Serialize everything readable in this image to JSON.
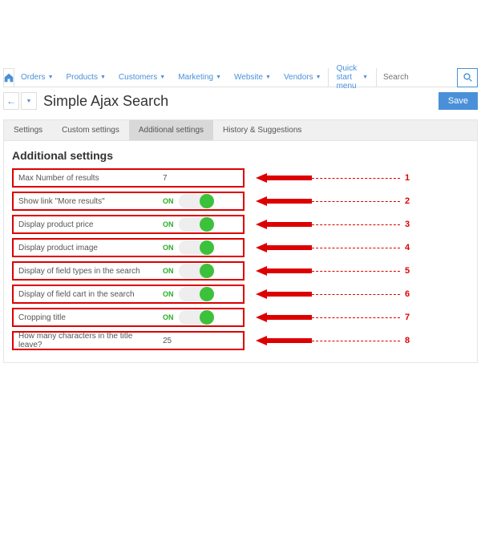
{
  "nav": {
    "items": [
      {
        "label": "Orders"
      },
      {
        "label": "Products"
      },
      {
        "label": "Customers"
      },
      {
        "label": "Marketing"
      },
      {
        "label": "Website"
      },
      {
        "label": "Vendors"
      }
    ],
    "quickstart": "Quick start menu",
    "search_placeholder": "Search"
  },
  "header": {
    "title": "Simple Ajax Search",
    "save": "Save"
  },
  "tabs": [
    {
      "label": "Settings"
    },
    {
      "label": "Custom settings"
    },
    {
      "label": "Additional settings"
    },
    {
      "label": "History & Suggestions"
    }
  ],
  "section_title": "Additional settings",
  "settings": [
    {
      "label": "Max Number of results",
      "type": "text",
      "value": "7",
      "num": "1"
    },
    {
      "label": "Show link \"More results\"",
      "type": "toggle",
      "on": "ON",
      "num": "2"
    },
    {
      "label": "Display product price",
      "type": "toggle",
      "on": "ON",
      "num": "3"
    },
    {
      "label": "Display product image",
      "type": "toggle",
      "on": "ON",
      "num": "4"
    },
    {
      "label": "Display of field types in the search",
      "type": "toggle",
      "on": "ON",
      "num": "5"
    },
    {
      "label": "Display of field cart in the search",
      "type": "toggle",
      "on": "ON",
      "num": "6"
    },
    {
      "label": "Cropping title",
      "type": "toggle",
      "on": "ON",
      "num": "7"
    },
    {
      "label": "How many characters in the title leave?",
      "type": "text",
      "value": "25",
      "num": "8"
    }
  ]
}
